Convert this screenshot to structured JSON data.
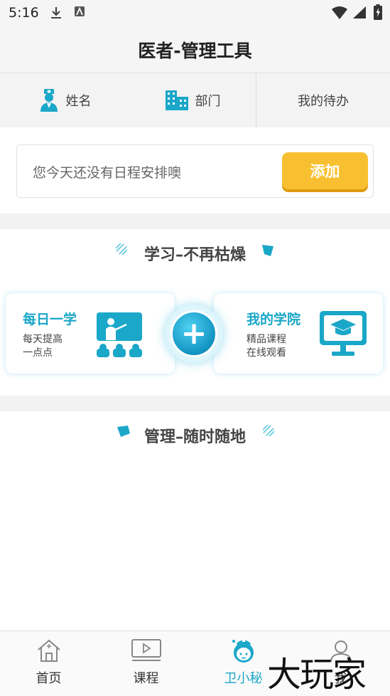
{
  "status_bar": {
    "time": "5:16"
  },
  "header": {
    "title": "医者-管理工具"
  },
  "info_bar": {
    "name_label": "姓名",
    "dept_label": "部门",
    "todo_label": "我的待办"
  },
  "schedule": {
    "message": "您今天还没有日程安排噢",
    "add_label": "添加"
  },
  "study_section": {
    "title": "学习–不再枯燥",
    "daily": {
      "title": "每日一学",
      "line1": "每天提高",
      "line2": "一点点"
    },
    "academy": {
      "title": "我的学院",
      "line1": "精品课程",
      "line2": "在线观看"
    }
  },
  "manage_section": {
    "title": "管理–随时随地"
  },
  "tabs": [
    {
      "label": "首页",
      "icon": "home-icon",
      "active": false
    },
    {
      "label": "课程",
      "icon": "video-icon",
      "active": false
    },
    {
      "label": "卫小秘",
      "icon": "nurse-avatar-icon",
      "active": true
    },
    {
      "label": "我",
      "icon": "profile-icon",
      "active": false
    }
  ],
  "watermark": "大玩家",
  "colors": {
    "accent": "#1aa7c8",
    "add_button": "#f8c030",
    "active_tab": "#1aa7c8"
  }
}
